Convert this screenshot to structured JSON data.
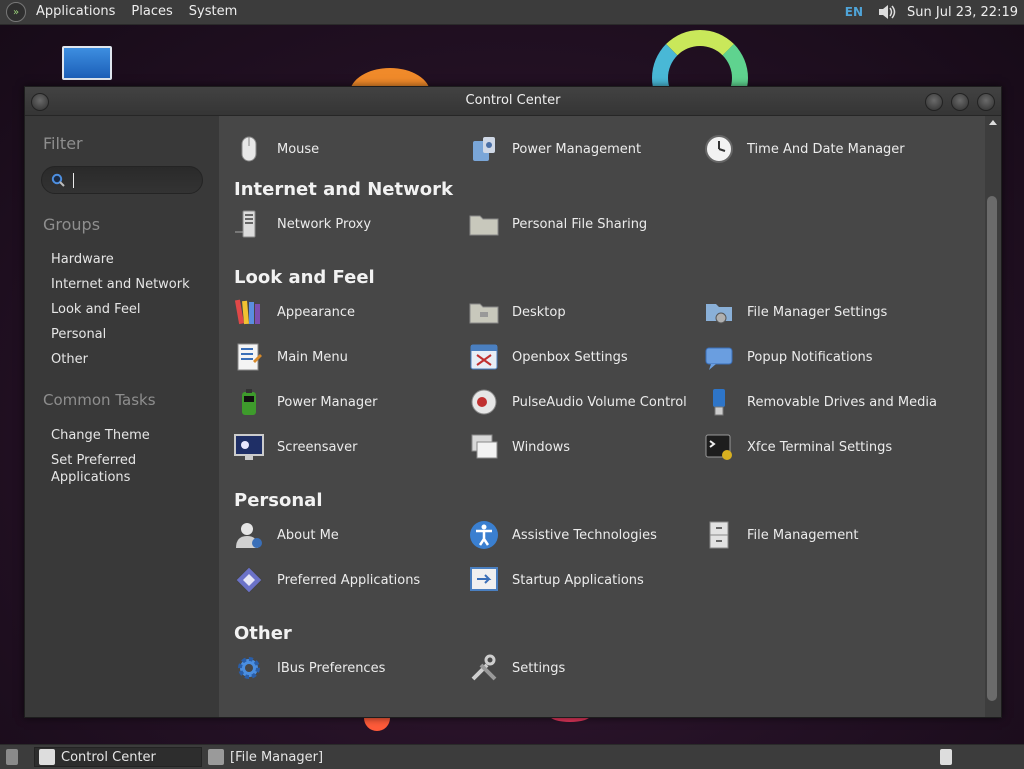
{
  "top_panel": {
    "menus": [
      "Applications",
      "Places",
      "System"
    ],
    "language": "EN",
    "clock": "Sun Jul 23, 22:19"
  },
  "window": {
    "title": "Control Center"
  },
  "sidebar": {
    "filter_heading": "Filter",
    "search_value": "",
    "groups_heading": "Groups",
    "groups": [
      "Hardware",
      "Internet and Network",
      "Look and Feel",
      "Personal",
      "Other"
    ],
    "tasks_heading": "Common Tasks",
    "tasks": [
      "Change Theme",
      "Set Preferred\nApplications"
    ]
  },
  "content": {
    "hardware_items": [
      {
        "label": "Mouse",
        "icon": "mouse-icon"
      },
      {
        "label": "Power Management",
        "icon": "power-management-icon"
      },
      {
        "label": "Time And Date Manager",
        "icon": "clock-icon"
      }
    ],
    "sections": [
      {
        "title": "Internet and Network",
        "items": [
          {
            "label": "Network Proxy",
            "icon": "network-proxy-icon"
          },
          {
            "label": "Personal File Sharing",
            "icon": "folder-share-icon"
          }
        ]
      },
      {
        "title": "Look and Feel",
        "items": [
          {
            "label": "Appearance",
            "icon": "palette-icon"
          },
          {
            "label": "Desktop",
            "icon": "desktop-folder-icon"
          },
          {
            "label": "File Manager Settings",
            "icon": "file-manager-settings-icon"
          },
          {
            "label": "Main Menu",
            "icon": "main-menu-icon"
          },
          {
            "label": "Openbox Settings",
            "icon": "openbox-icon"
          },
          {
            "label": "Popup Notifications",
            "icon": "notification-icon"
          },
          {
            "label": "Power Manager",
            "icon": "battery-icon"
          },
          {
            "label": "PulseAudio Volume Control",
            "icon": "speaker-icon"
          },
          {
            "label": "Removable Drives and Media",
            "icon": "usb-drive-icon"
          },
          {
            "label": "Screensaver",
            "icon": "screensaver-icon"
          },
          {
            "label": "Windows",
            "icon": "windows-icon"
          },
          {
            "label": "Xfce Terminal Settings",
            "icon": "terminal-icon"
          }
        ]
      },
      {
        "title": "Personal",
        "items": [
          {
            "label": "About Me",
            "icon": "user-info-icon"
          },
          {
            "label": "Assistive Technologies",
            "icon": "accessibility-icon"
          },
          {
            "label": "File Management",
            "icon": "filing-cabinet-icon"
          },
          {
            "label": "Preferred Applications",
            "icon": "preferred-apps-icon"
          },
          {
            "label": "Startup Applications",
            "icon": "startup-icon"
          }
        ]
      },
      {
        "title": "Other",
        "items": [
          {
            "label": "IBus Preferences",
            "icon": "gear-icon"
          },
          {
            "label": "Settings",
            "icon": "tools-icon"
          }
        ]
      }
    ]
  },
  "taskbar": {
    "tasks": [
      "Control Center",
      "[File Manager]"
    ]
  }
}
